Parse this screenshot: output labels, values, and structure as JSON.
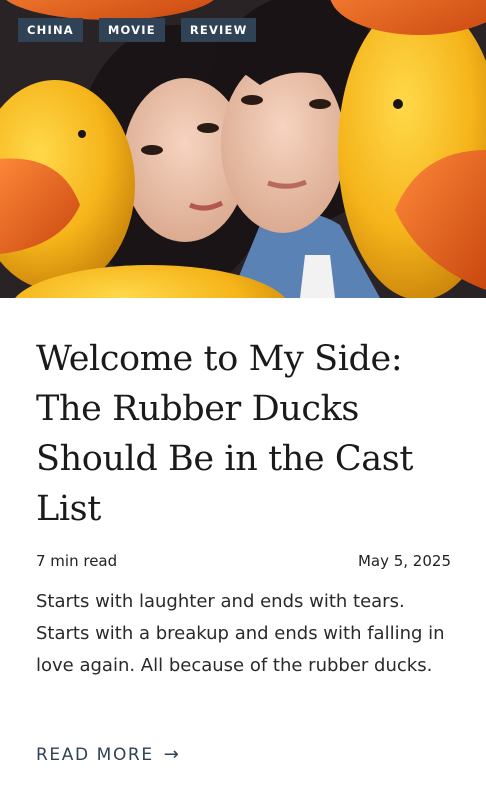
{
  "article": {
    "tags": [
      "CHINA",
      "MOVIE",
      "REVIEW"
    ],
    "title": "Welcome to My Side: The Rubber Ducks Should Be in the Cast List",
    "read_time": "7 min read",
    "date": "May 5, 2025",
    "excerpt": "Starts with laughter and ends with tears. Starts with a breakup and ends with falling in love again. All because of the rubber ducks.",
    "read_more_label": "READ MORE",
    "read_more_icon": "arrow-right-icon"
  },
  "colors": {
    "tag_bg": "#2f4256",
    "link": "#2f4256",
    "duck_yellow": "#f5b41a",
    "duck_beak": "#e8621c"
  }
}
